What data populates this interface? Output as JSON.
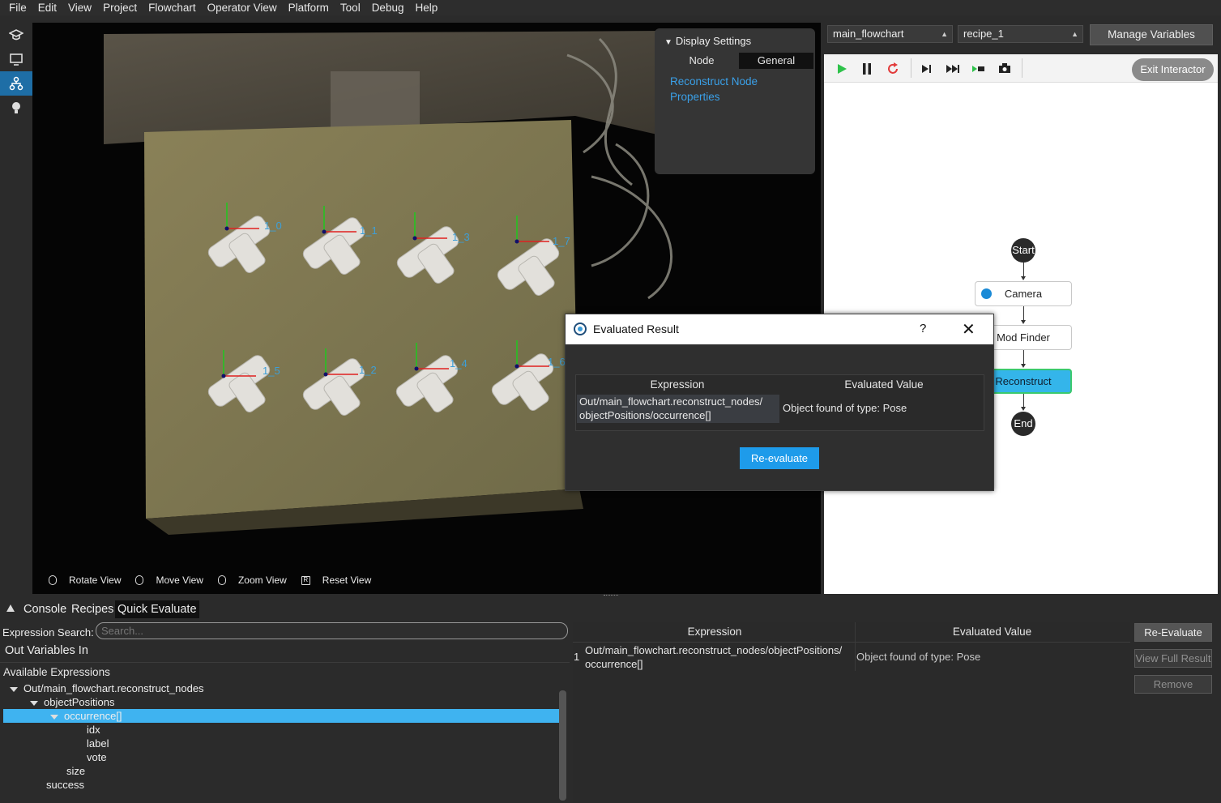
{
  "menu": [
    "File",
    "Edit",
    "View",
    "Project",
    "Flowchart",
    "Operator View",
    "Platform",
    "Tool",
    "Debug",
    "Help"
  ],
  "rail_icons": [
    "graduation-icon",
    "monitor-icon",
    "flowchart-icon",
    "lightbulb-icon"
  ],
  "viewport": {
    "pose_labels": [
      "1_0",
      "1_1",
      "1_3",
      "1_7",
      "1_5",
      "1_2",
      "1_4",
      "1_6"
    ],
    "view_controls": [
      "Rotate View",
      "Move View",
      "Zoom View",
      "Reset View"
    ],
    "reset_key": "R"
  },
  "display_settings": {
    "title": "Display Settings",
    "tabs": [
      "Node",
      "General"
    ],
    "link": "Reconstruct Node Properties"
  },
  "flowchart": {
    "flowchart_select": "main_flowchart",
    "recipe_select": "recipe_1",
    "manage_variables": "Manage Variables",
    "exit_interactor": "Exit Interactor",
    "nodes": {
      "start": "Start",
      "camera": "Camera",
      "mod_finder": "Mod Finder",
      "reconstruct": "Reconstruct",
      "end": "End"
    },
    "colors": {
      "play": "#2ec24a",
      "restart": "#e23b3b",
      "active_node": "#34b5ea",
      "active_border": "#3bc96d"
    }
  },
  "dialog": {
    "title": "Evaluated Result",
    "help": "?",
    "col_expression": "Expression",
    "col_value": "Evaluated Value",
    "expression_line1": "Out/main_flowchart.reconstruct_nodes/",
    "expression_line2": "objectPositions/occurrence[]",
    "value": "Object found of type: Pose",
    "button": "Re-evaluate"
  },
  "bottom": {
    "tabs": [
      "Console",
      "Recipes",
      "Quick Evaluate"
    ],
    "search_label": "Expression Search:",
    "search_placeholder": "Search...",
    "out_vars": "Out Variables In",
    "available": "Available Expressions",
    "tree": {
      "root": "Out/main_flowchart.reconstruct_nodes",
      "object_positions": "objectPositions",
      "occurrence": "occurrence[]",
      "idx": "idx",
      "label": "label",
      "vote": "vote",
      "size": "size",
      "success": "success"
    },
    "table": {
      "col_expression": "Expression",
      "col_value": "Evaluated Value",
      "row_num": "1",
      "expr_line1": "Out/main_flowchart.reconstruct_nodes/objectPositions/",
      "expr_line2": "occurrence[]",
      "value": "Object found of type: Pose"
    },
    "buttons": {
      "reevaluate": "Re-Evaluate",
      "view_full": "View Full Result",
      "remove": "Remove"
    }
  }
}
